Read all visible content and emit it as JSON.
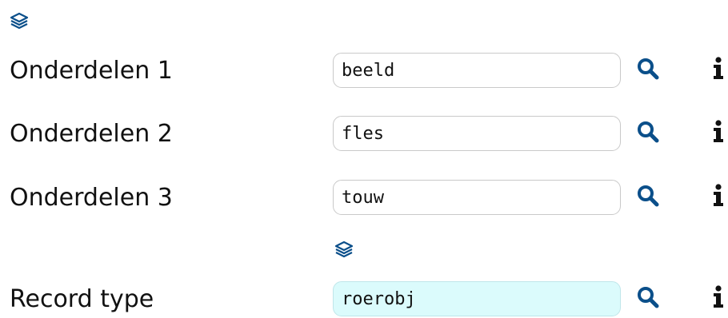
{
  "top_icon": "layers-icon",
  "rows": [
    {
      "label": "Onderdelen 1",
      "value": "beeld"
    },
    {
      "label": "Onderdelen 2",
      "value": "fles"
    },
    {
      "label": "Onderdelen 3",
      "value": "touw"
    }
  ],
  "group_icon": "layers-icon",
  "record": {
    "label": "Record type",
    "value": "roerobj"
  },
  "icons": {
    "search": "search-icon",
    "info": "info-icon"
  },
  "colors": {
    "accent": "#0b4f8a",
    "highlight_field": "#dbfbfc",
    "text": "#111111"
  }
}
